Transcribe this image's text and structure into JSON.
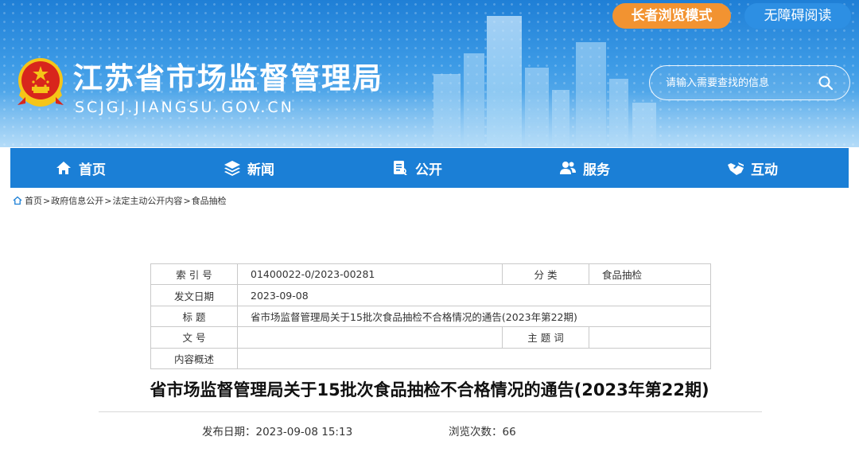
{
  "header": {
    "site_name": "江苏省市场监督管理局",
    "site_domain": "SCJGJ.JIANGSU.GOV.CN",
    "elder_mode_label": "长者浏览模式",
    "accessibility_label": "无障碍阅读",
    "search_placeholder": "请输入需要查找的信息",
    "emblem_icon": "national-emblem-icon"
  },
  "nav": {
    "items": [
      {
        "label": "首页",
        "icon": "home-icon"
      },
      {
        "label": "新闻",
        "icon": "layers-icon"
      },
      {
        "label": "公开",
        "icon": "document-icon"
      },
      {
        "label": "服务",
        "icon": "users-icon"
      },
      {
        "label": "互动",
        "icon": "handshake-icon"
      }
    ]
  },
  "breadcrumb": {
    "items": [
      "首页",
      "政府信息公开",
      "法定主动公开内容",
      "食品抽检"
    ],
    "separator": ">"
  },
  "meta_table": {
    "index_label": "索 引 号",
    "index_value": "01400022-0/2023-00281",
    "category_label": "分 类",
    "category_value": "食品抽检",
    "date_label": "发文日期",
    "date_value": "2023-09-08",
    "title_label": "标 题",
    "title_value": "省市场监督管理局关于15批次食品抽检不合格情况的通告(2023年第22期)",
    "docno_label": "文 号",
    "docno_value": "",
    "keywords_label": "主 题 词",
    "keywords_value": "",
    "summary_label": "内容概述",
    "summary_value": ""
  },
  "article": {
    "title": "省市场监督管理局关于15批次食品抽检不合格情况的通告(2023年第22期)",
    "publish_label": "发布日期：",
    "publish_value": "2023-09-08 15:13",
    "views_label": "浏览次数：",
    "views_value": "66"
  },
  "colors": {
    "header_blue": "#1f7fd6",
    "nav_blue": "#1b7fd6",
    "elder_orange": "#f29331",
    "emblem_red": "#d8261c",
    "emblem_gold": "#f5c518"
  }
}
